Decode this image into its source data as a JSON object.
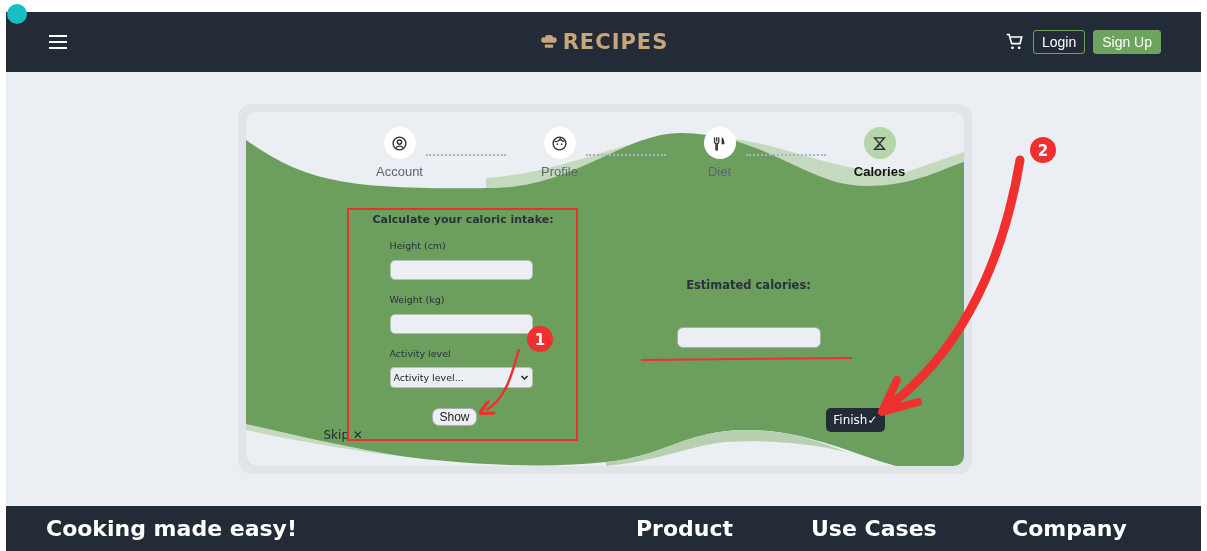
{
  "header": {
    "logo": "RECIPES",
    "buttons": [
      {
        "label": "Login",
        "kind": "outline"
      },
      {
        "label": "Sign Up",
        "kind": "filled"
      }
    ]
  },
  "steps": [
    {
      "label": "Account",
      "selected": false
    },
    {
      "label": "Profile",
      "selected": false
    },
    {
      "label": "Diet",
      "selected": false
    },
    {
      "label": "Calories",
      "selected": true
    }
  ],
  "form": {
    "title": "Calculate your caloric intake:",
    "fields": [
      {
        "label": "Height (cm)",
        "kind": "text"
      },
      {
        "label": "Weight (kg)",
        "kind": "text"
      },
      {
        "label": "Activity level",
        "kind": "select",
        "value": "Activity level..."
      }
    ],
    "button": "Show"
  },
  "result": {
    "label": "Estimated calories:"
  },
  "skip": {
    "label": "Skip",
    "icon": "✕"
  },
  "finish": {
    "label": "Finish",
    "icon": "✓"
  },
  "annotations": [
    {
      "number": "1"
    },
    {
      "number": "2"
    }
  ],
  "footer": {
    "tagline": "Cooking made easy!",
    "columns": [
      "Product",
      "Use Cases",
      "Company"
    ]
  }
}
